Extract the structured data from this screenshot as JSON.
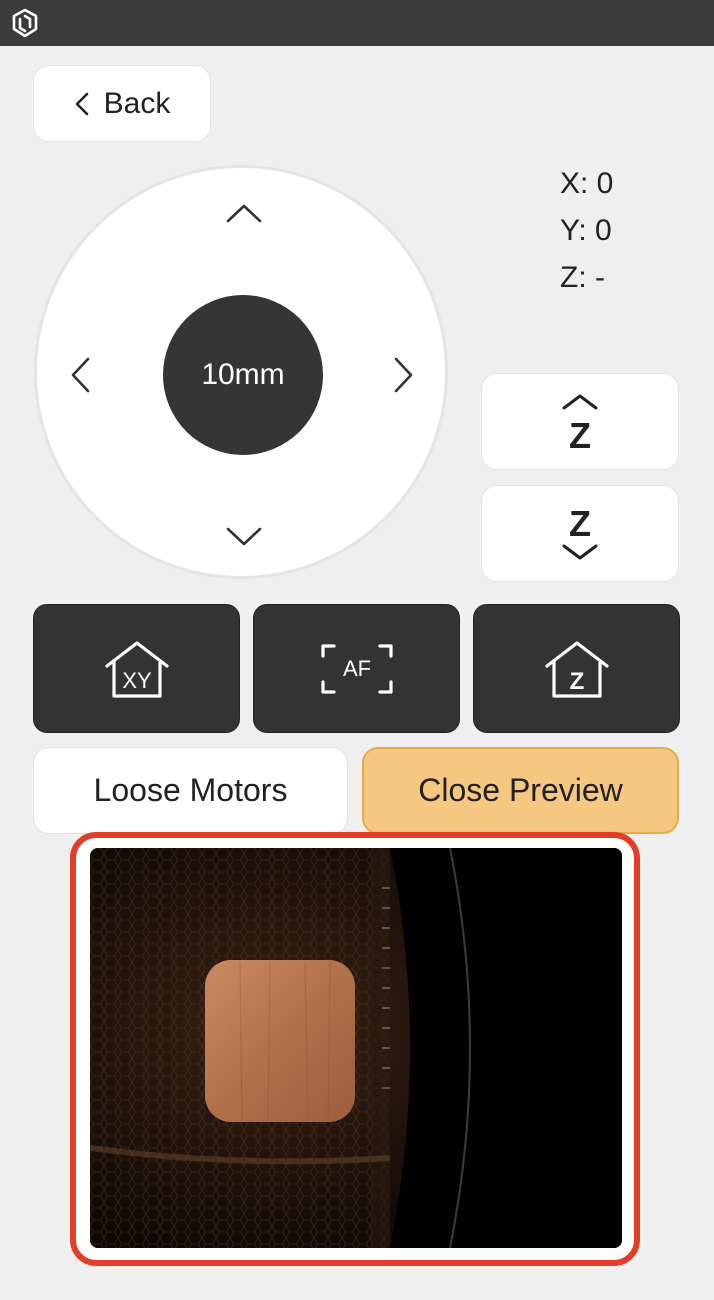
{
  "titlebar": {
    "logo_icon": "app-logo-icon"
  },
  "back": {
    "label": "Back",
    "icon": "chevron-left-icon"
  },
  "jog": {
    "step_label": "10mm",
    "icons": [
      "chevron-up-icon",
      "chevron-down-icon",
      "chevron-left-icon",
      "chevron-right-icon"
    ]
  },
  "coords": {
    "x": "X: 0",
    "y": "Y: 0",
    "z": "Z: -"
  },
  "z_controls": {
    "up_label": "Z",
    "down_label": "Z"
  },
  "action_buttons": {
    "home_xy_label": "XY",
    "autofocus_label": "AF",
    "home_z_label": "Z"
  },
  "buttons": {
    "loose_motors": "Loose Motors",
    "close_preview": "Close Preview"
  },
  "colors": {
    "titlebar": "#3b3b3b",
    "dark_button": "#333333",
    "accent_orange": "#f6c781",
    "highlight_red": "#e33d27"
  }
}
